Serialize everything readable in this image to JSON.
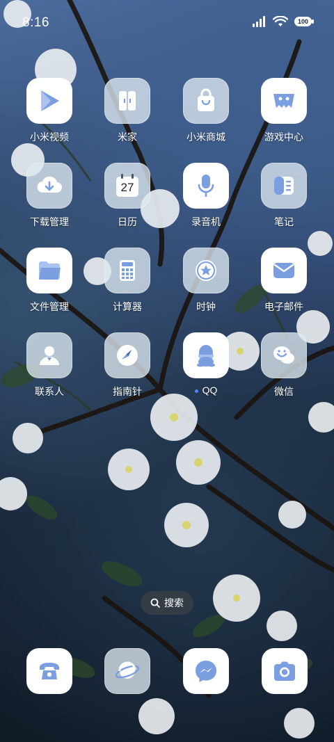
{
  "status": {
    "time": "8:16",
    "battery_text": "100"
  },
  "apps": [
    {
      "name": "app-mi-video",
      "label": "小米视频",
      "icon": "play-triangle-icon"
    },
    {
      "name": "app-mi-home",
      "label": "米家",
      "icon": "door-icon"
    },
    {
      "name": "app-mi-store",
      "label": "小米商城",
      "icon": "shopping-bag-icon"
    },
    {
      "name": "app-game-center",
      "label": "游戏中心",
      "icon": "ghost-icon"
    },
    {
      "name": "app-downloads",
      "label": "下载管理",
      "icon": "cloud-download-icon"
    },
    {
      "name": "app-calendar",
      "label": "日历",
      "icon": "calendar-icon",
      "day": "27"
    },
    {
      "name": "app-recorder",
      "label": "录音机",
      "icon": "microphone-icon"
    },
    {
      "name": "app-notes",
      "label": "笔记",
      "icon": "notebook-icon"
    },
    {
      "name": "app-file-manager",
      "label": "文件管理",
      "icon": "folder-icon"
    },
    {
      "name": "app-calculator",
      "label": "计算器",
      "icon": "calculator-icon"
    },
    {
      "name": "app-clock",
      "label": "时钟",
      "icon": "clock-star-icon"
    },
    {
      "name": "app-email",
      "label": "电子邮件",
      "icon": "envelope-icon"
    },
    {
      "name": "app-contacts",
      "label": "联系人",
      "icon": "person-icon"
    },
    {
      "name": "app-compass",
      "label": "指南针",
      "icon": "compass-icon"
    },
    {
      "name": "app-qq",
      "label": "QQ",
      "icon": "penguin-icon"
    },
    {
      "name": "app-wechat",
      "label": "微信",
      "icon": "chat-bubbles-icon"
    }
  ],
  "search": {
    "label": "搜索"
  },
  "dock": [
    {
      "name": "dock-phone",
      "icon": "phone-icon"
    },
    {
      "name": "dock-browser",
      "icon": "planet-icon"
    },
    {
      "name": "dock-messages",
      "icon": "messenger-icon"
    },
    {
      "name": "dock-camera",
      "icon": "camera-icon"
    }
  ],
  "colors": {
    "accent": "#6f93d6",
    "icon_blue": "#7a9ee0",
    "notify_dot": "#4a8cff"
  }
}
